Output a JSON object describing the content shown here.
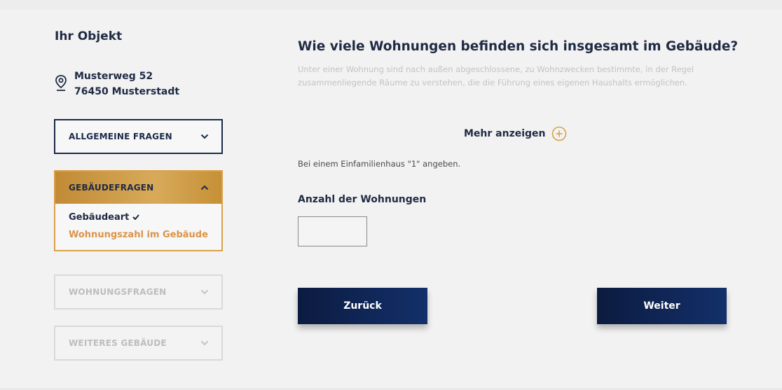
{
  "sidebar": {
    "title": "Ihr Objekt",
    "address": {
      "street": "Musterweg 52",
      "city": "76450 Musterstadt",
      "icon": "location-pin-icon"
    },
    "sections": [
      {
        "label": "ALLGEMEINE FRAGEN",
        "state": "collapsed"
      },
      {
        "label": "GEBÄUDEFRAGEN",
        "state": "expanded",
        "items": [
          {
            "label": "Gebäudeart",
            "completed": true
          },
          {
            "label": "Wohnungszahl im Gebäude",
            "active": true
          }
        ]
      },
      {
        "label": "WOHNUNGSFRAGEN",
        "state": "disabled"
      },
      {
        "label": "WEITERES GEBÄUDE",
        "state": "disabled"
      }
    ]
  },
  "main": {
    "question": "Wie viele Wohnungen befinden sich insgesamt im Gebäude?",
    "description": "Unter einer Wohnung sind nach außen abgeschlossene, zu Wohnzwecken bestimmte, in der Regel zusammenliegende Räume zu verstehen, die die Führung eines eigenen Haushalts ermöglichen.",
    "more_label": "Mehr anzeigen",
    "hint": "Bei einem Einfamilienhaus \"1\" angeben.",
    "field_label": "Anzahl der Wohnungen",
    "field_value": "",
    "back_label": "Zurück",
    "next_label": "Weiter"
  },
  "colors": {
    "navy": "#1b2a4a",
    "gold": "#d9a14a",
    "button": "#0c1b40",
    "background": "#f2f2f2"
  }
}
